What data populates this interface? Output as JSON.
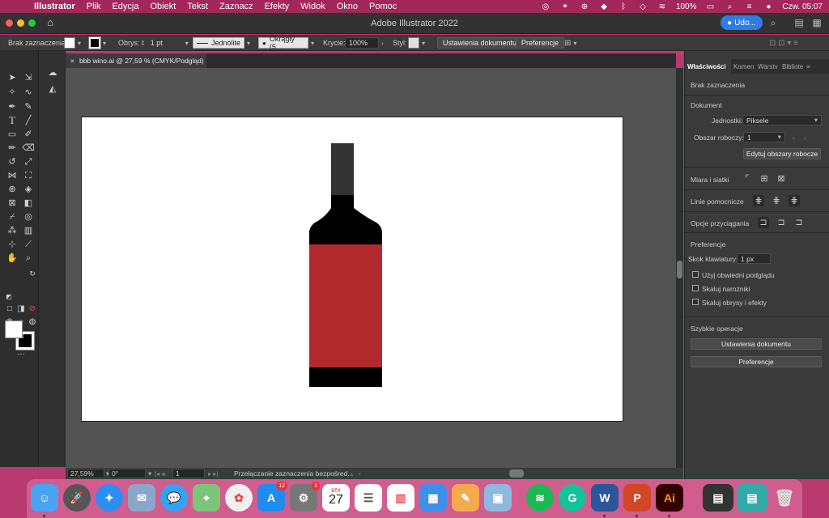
{
  "menubar": {
    "app_name": "Illustrator",
    "items": [
      "Plik",
      "Edycja",
      "Obiekt",
      "Tekst",
      "Zaznacz",
      "Efekty",
      "Widok",
      "Okno",
      "Pomoc"
    ],
    "battery": "100%",
    "clock": "Czw. 05:07"
  },
  "titlebar": {
    "title": "Adobe Illustrator 2022",
    "user_label": "Udo..."
  },
  "controlbar": {
    "selection_label": "Brak zaznaczenia",
    "stroke_label": "Obrys:",
    "stroke_value": "1 pt",
    "stroke_style": "Jednolite",
    "brush_label": "Okrągły (5...",
    "opacity_label": "Krycie:",
    "opacity_value": "100%",
    "style_label": "Styl:",
    "doc_setup_btn": "Ustawienia dokumentu",
    "prefs_btn": "Preferencje"
  },
  "document": {
    "tab_title": "bbb wino.ai @ 27,59 % (CMYK/Podgląd)",
    "colors": {
      "cap": "#333333",
      "body": "#000000",
      "label": "#b2292e"
    }
  },
  "statusbar": {
    "zoom": "27,59%",
    "rotation": "0°",
    "artboard_num": "1",
    "tool_hint": "Przełączanie zaznaczenia bezpośred..."
  },
  "properties_panel": {
    "tabs": [
      "Właściwości",
      "Komen",
      "Warstv",
      "Bibliote"
    ],
    "no_selection": "Brak zaznaczenia",
    "document_section": "Dokument",
    "units_label": "Jednostki:",
    "units_value": "Piksele",
    "artboard_label": "Obszar roboczy:",
    "artboard_value": "1",
    "edit_artboards_btn": "Edytuj obszary robocze",
    "rulers_grids": "Miara i siatki",
    "guides": "Linie pomocnicze",
    "snap_options": "Opcje przyciągania",
    "prefs_section": "Preferencje",
    "keyboard_inc_label": "Skok klawiatury:",
    "keyboard_inc_value": "1 px",
    "chk_preview_bounds": "Użyj obwiedni podglądu",
    "chk_scale_corners": "Skaluj narożniki",
    "chk_scale_strokes": "Skaluj obrysy i efekty",
    "quick_actions": "Szybkie operacje",
    "qa_doc_setup": "Ustawienia dokumentu",
    "qa_prefs": "Preferencje"
  },
  "dock": {
    "calendar_month": "STY",
    "calendar_day": "27",
    "appstore_badge": "12",
    "settings_badge": "1",
    "word_label": "W",
    "ppt_label": "P",
    "ai_label": "Ai"
  }
}
